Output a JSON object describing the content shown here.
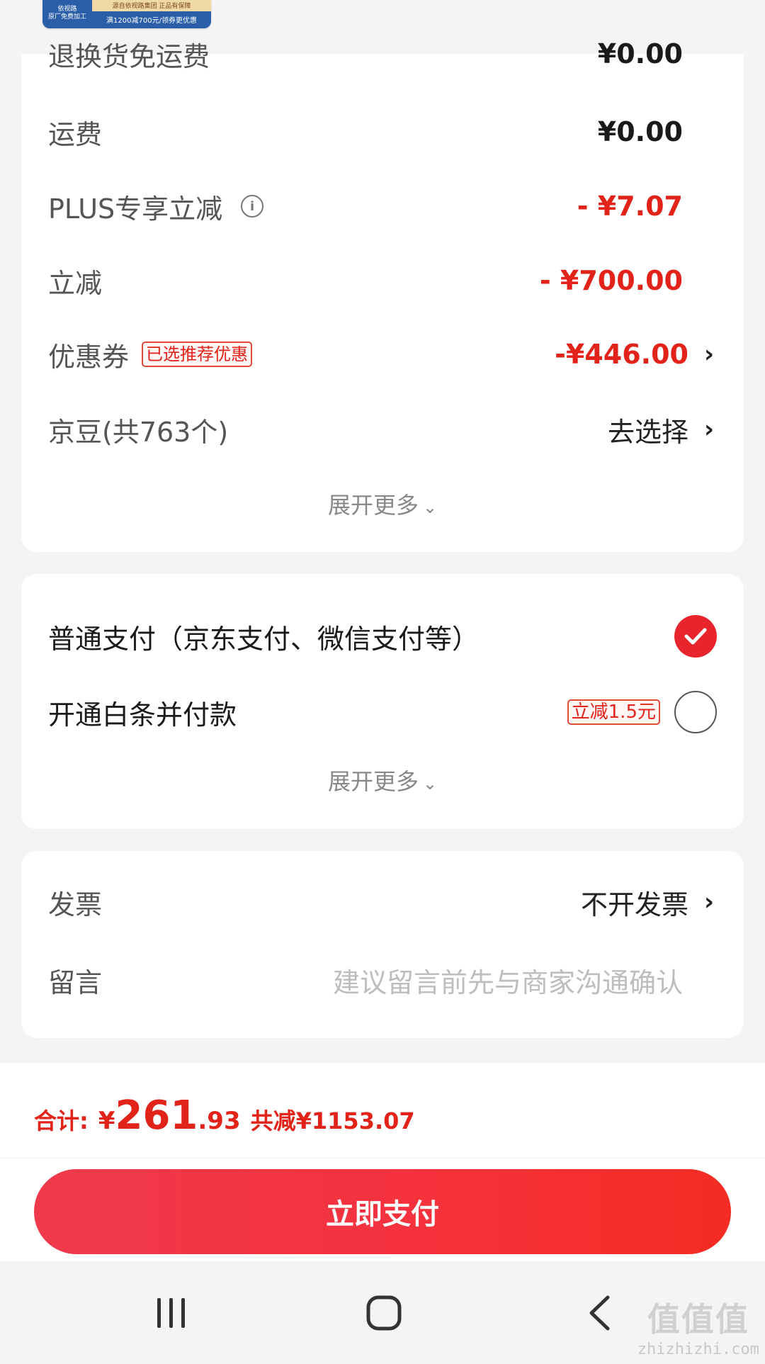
{
  "banner": {
    "left_text_1": "依视路",
    "left_text_2": "原厂免费加工",
    "top_text": "源自依视路集团 正品有保障",
    "bottom_text": "满1200减700元/领券更优惠"
  },
  "fees": {
    "partial_label": "退换货免运费",
    "partial_value": "¥0.00",
    "rows": [
      {
        "label": "运费",
        "value": "¥0.00"
      },
      {
        "label": "PLUS专享立减",
        "value": "- ¥7.07"
      },
      {
        "label": "立减",
        "value": "- ¥700.00"
      },
      {
        "label": "优惠券",
        "tag": "已选推荐优惠",
        "value": "-¥446.00"
      },
      {
        "label": "京豆(共763个)",
        "value": "去选择"
      }
    ],
    "expand": "展开更多"
  },
  "payment": {
    "options": [
      {
        "label": "普通支付（京东支付、微信支付等）",
        "selected": true
      },
      {
        "label": "开通白条并付款",
        "tag": "立减1.5元",
        "selected": false
      }
    ],
    "expand": "展开更多"
  },
  "extra": {
    "invoice_label": "发票",
    "invoice_value": "不开发票",
    "message_label": "留言",
    "message_placeholder": "建议留言前先与商家沟通确认"
  },
  "summary": {
    "total_label": "合计:",
    "currency": "¥",
    "total_int": "261",
    "total_dec": ".93",
    "saved": "共减¥1153.07"
  },
  "pay_button": "立即支付",
  "watermark": {
    "logo": "值值值",
    "site": "zhizhizhi.com"
  },
  "colors": {
    "accent_red": "#e2231a",
    "button_red": "#f5323f"
  }
}
